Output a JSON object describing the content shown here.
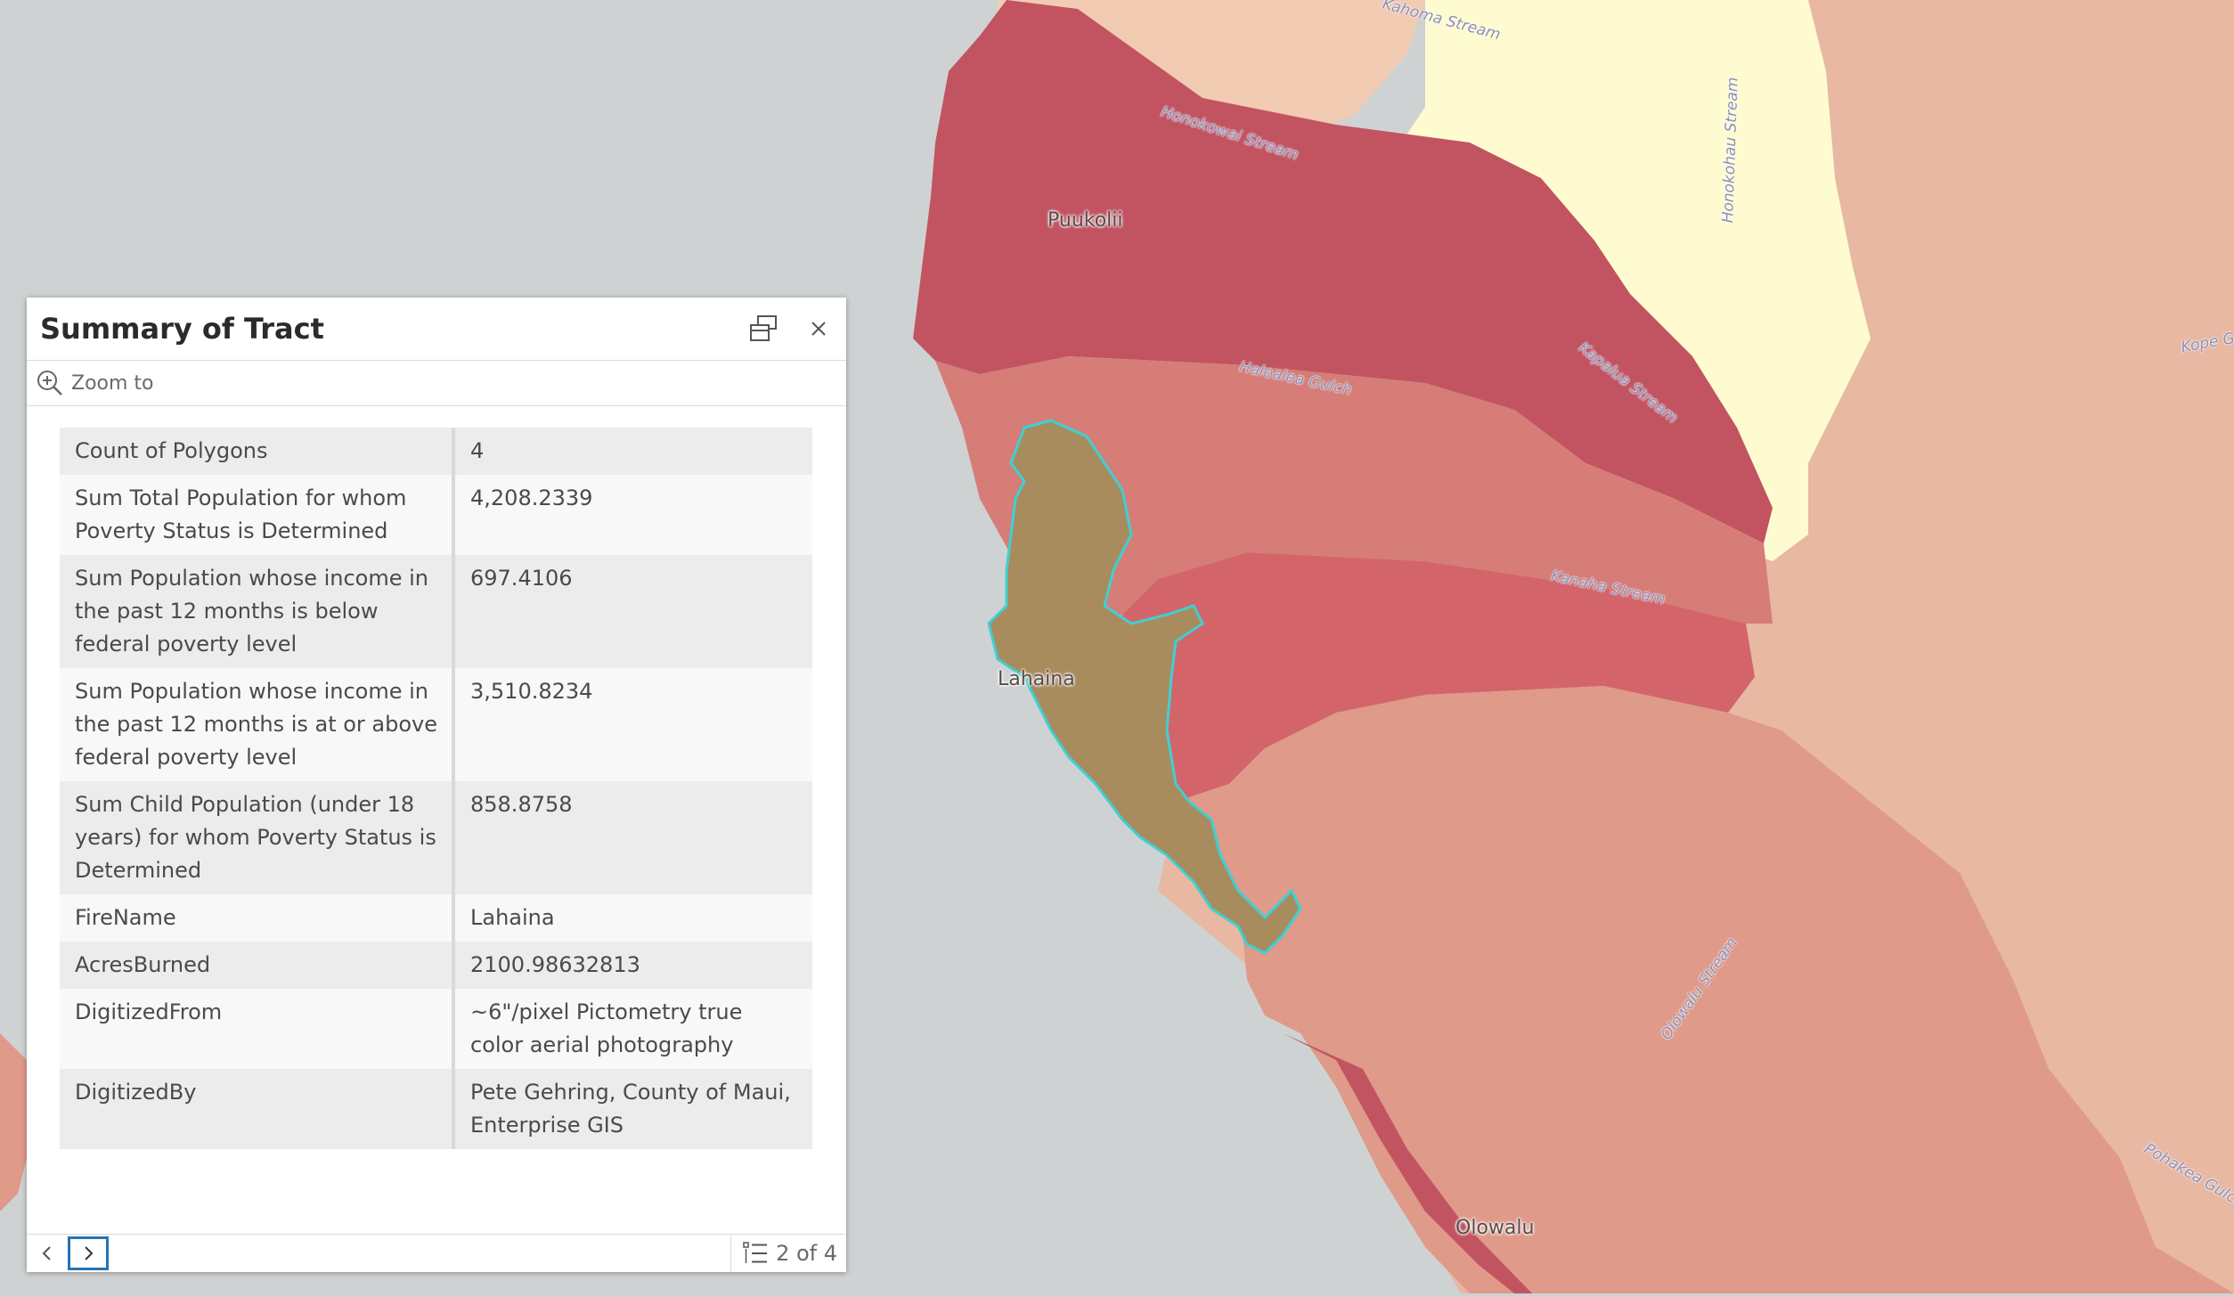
{
  "map": {
    "place_labels": [
      "Puukolii",
      "Lahaina",
      "Olowalu"
    ],
    "stream_labels": [
      "Kahoma Stream",
      "Honokowai Stream",
      "Halealea Gulch",
      "Kapalua Stream",
      "Honokohau Stream",
      "Kanaha Stream",
      "Olowalu Stream",
      "Pohakea Gulch",
      "Kope Gulch"
    ],
    "colors": {
      "water": "#cfd2d3",
      "lightest": "#fffbd1",
      "light": "#f1cbb2",
      "medium_light": "#e8b8a2",
      "medium": "#df9a8a",
      "medium_dark": "#d67d78",
      "dark": "#d3656a",
      "darkest": "#c25462",
      "burn_area": "#a88c5e",
      "burn_outline": "#3fd0d2"
    }
  },
  "popup": {
    "title": "Summary of Tract",
    "dock_icon": "dock-icon",
    "close_icon": "close-icon",
    "zoom_label": "Zoom to",
    "zoom_icon": "zoom-in-icon",
    "rows": [
      {
        "key": "Count of Polygons",
        "value": "4"
      },
      {
        "key": "Sum Total Population for whom Poverty Status is Determined",
        "value": "4,208.2339"
      },
      {
        "key": "Sum Population whose income in the past 12 months is below federal poverty level",
        "value": "697.4106"
      },
      {
        "key": "Sum Population whose income in the past 12 months is at or above federal poverty level",
        "value": "3,510.8234"
      },
      {
        "key": "Sum Child Population (under 18 years) for whom Poverty Status is Determined",
        "value": "858.8758"
      },
      {
        "key": "FireName",
        "value": "Lahaina"
      },
      {
        "key": "AcresBurned",
        "value": "2100.98632813"
      },
      {
        "key": "DigitizedFrom",
        "value": "~6\"/pixel Pictometry true color aerial photography"
      },
      {
        "key": "DigitizedBy",
        "value": "Pete Gehring, County of Maui, Enterprise GIS"
      }
    ],
    "footer": {
      "prev_icon": "chevron-left-icon",
      "next_icon": "chevron-right-icon",
      "list_icon": "list-icon",
      "pager": "2 of 4"
    }
  }
}
